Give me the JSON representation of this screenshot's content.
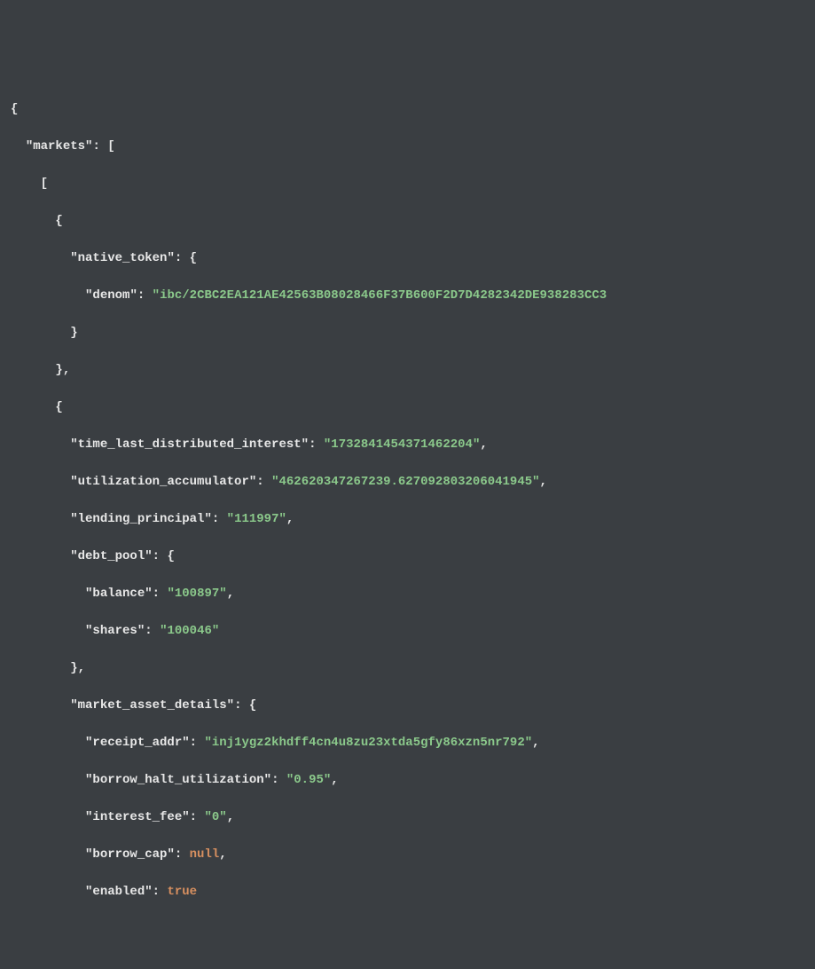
{
  "code": {
    "root_key": "markets",
    "native_token_key": "native_token",
    "denom_key": "denom",
    "denom_val": "ibc/2CBC2EA121AE42563B08028466F37B600F2D7D4282342DE938283CC3",
    "tldi_key": "time_last_distributed_interest",
    "tldi_val": "1732841454371462204",
    "ua_key": "utilization_accumulator",
    "ua_val": "462620347267239.627092803206041945",
    "lp_key": "lending_principal",
    "lp_val": "111997",
    "dp_key": "debt_pool",
    "balance_key": "balance",
    "balance_val": "100897",
    "shares_key": "shares",
    "shares_val": "100046",
    "mad_key": "market_asset_details",
    "ra_key": "receipt_addr",
    "ra_val": "inj1ygz2khdff4cn4u8zu23xtda5gfy86xzn5nr792",
    "bhu_key": "borrow_halt_utilization",
    "bhu_val": "0.95",
    "if_key": "interest_fee",
    "if_val": "0",
    "bc_key": "borrow_cap",
    "bc_val": "null",
    "en_key": "enabled",
    "en_val": "true"
  }
}
